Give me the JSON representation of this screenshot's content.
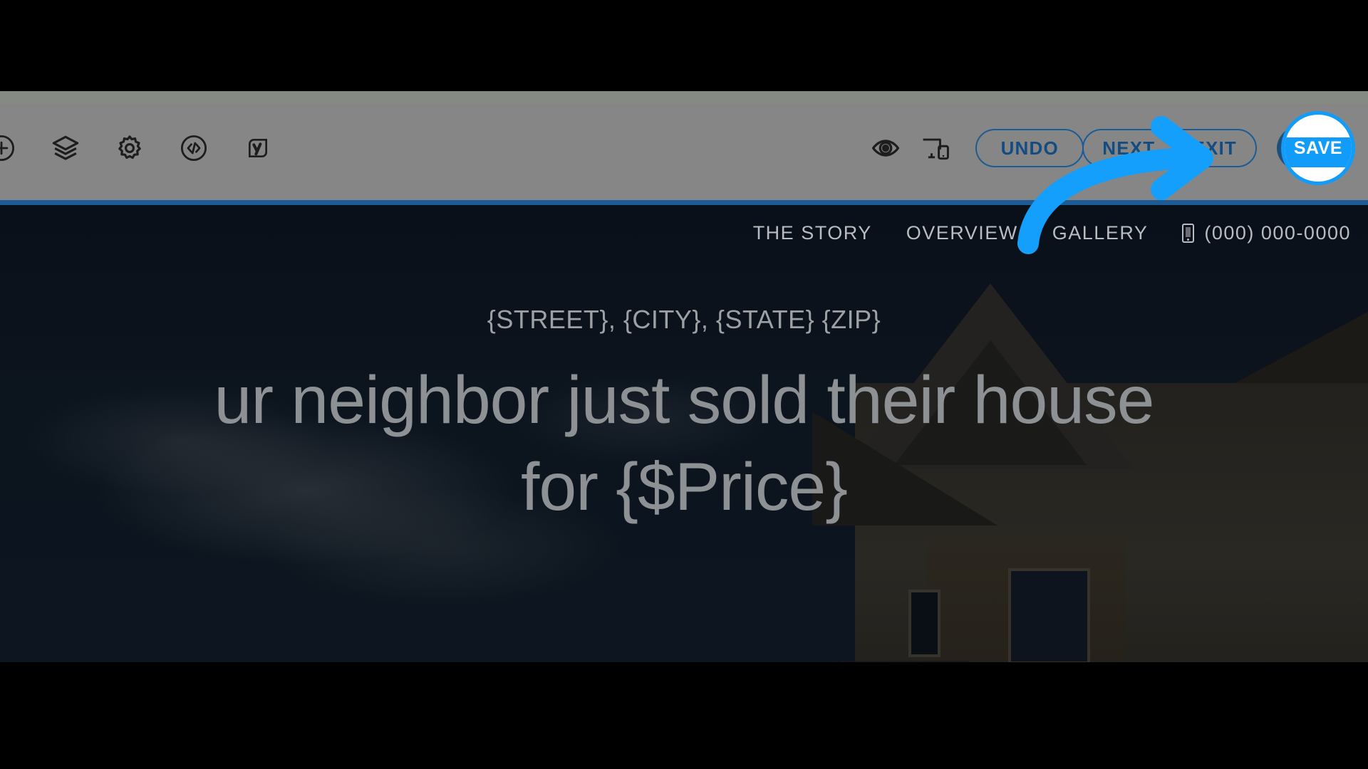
{
  "editor_toolbar": {
    "left_icons": [
      {
        "name": "add-block-icon",
        "label": "Add"
      },
      {
        "name": "layers-icon",
        "label": "Layers"
      },
      {
        "name": "settings-gear-icon",
        "label": "Settings"
      },
      {
        "name": "code-embed-icon",
        "label": "Code"
      },
      {
        "name": "yoast-seo-icon",
        "label": "Yoast SEO"
      }
    ],
    "right_icons": [
      {
        "name": "preview-eye-icon",
        "label": "Preview"
      },
      {
        "name": "responsive-devices-icon",
        "label": "Responsive"
      }
    ],
    "undo_label": "UNDO",
    "next_label": "NEXT",
    "exit_label": "EXIT",
    "save_label": "SAVE",
    "accent_color": "#1b5c96",
    "save_color": "#109cf8",
    "toolbar_color": "#868686"
  },
  "site": {
    "nav": [
      {
        "name": "nav-the-story",
        "label": "THE STORY"
      },
      {
        "name": "nav-overview",
        "label": "OVERVIEW"
      },
      {
        "name": "nav-gallery",
        "label": "GALLERY"
      }
    ],
    "phone": "(000) 000-0000",
    "hero": {
      "address": "{STREET}, {CITY}, {STATE} {ZIP}",
      "headline_line1": "ur neighbor just sold their house",
      "headline_line2": "for {$Price}"
    },
    "background_color": "#0b1119"
  },
  "annotation": {
    "name": "click-target-arrow",
    "points_at": "EXIT",
    "color": "#109cf8"
  }
}
